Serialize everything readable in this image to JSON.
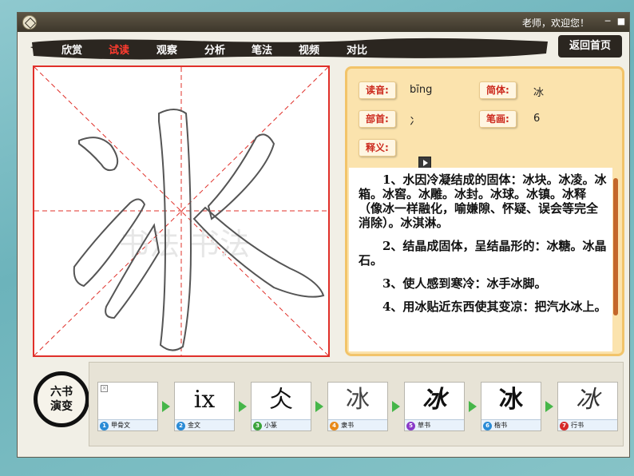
{
  "titlebar": {
    "welcome": "老师，欢迎您！",
    "minimize_icon": "minimize-icon",
    "close_icon": "close-icon",
    "colors": {
      "bar": "#4a4436"
    }
  },
  "nav": {
    "items": [
      {
        "label": "欣赏",
        "active": false
      },
      {
        "label": "试读",
        "active": true
      },
      {
        "label": "观察",
        "active": false
      },
      {
        "label": "分析",
        "active": false
      },
      {
        "label": "笔法",
        "active": false
      },
      {
        "label": "视频",
        "active": false
      },
      {
        "label": "对比",
        "active": false
      }
    ],
    "home_label": "返回首页",
    "active_color": "#ff3b2f"
  },
  "character": {
    "glyph": "冰",
    "grid_color": "#e0302a",
    "watermark": "书法 书法"
  },
  "info": {
    "pinyin_label": "读音:",
    "pinyin_value": "bīng",
    "simplified_label": "简体:",
    "simplified_value": "冰",
    "radical_label": "部首:",
    "radical_value": "冫",
    "strokes_label": "笔画:",
    "strokes_value": "6",
    "definition_label": "释义:",
    "play_icon": "play-icon",
    "definitions": [
      "1、水因冷凝结成的固体：冰块。冰凌。冰箱。冰窖。冰雕。冰封。冰球。冰镇。冰释（像冰一样融化，喻嫌隙、怀疑、误会等完全消除）。冰淇淋。",
      "2、结晶成固体，呈结晶形的：冰糖。冰晶石。",
      "3、使人感到寒冷：冰手冰脚。",
      "4、用冰贴近东西使其变凉：把汽水冰上。"
    ]
  },
  "evolution": {
    "badge_line1": "六书",
    "badge_line2": "演变",
    "stages": [
      {
        "num": "1",
        "label": "甲骨文",
        "glyph": "",
        "color": "#2a8bd6"
      },
      {
        "num": "2",
        "label": "金文",
        "glyph": "ⅸ",
        "color": "#2a8bd6"
      },
      {
        "num": "3",
        "label": "小篆",
        "glyph": "仌",
        "color": "#3aa33a"
      },
      {
        "num": "4",
        "label": "隶书",
        "glyph": "冰",
        "color": "#e88a1a"
      },
      {
        "num": "5",
        "label": "草书",
        "glyph": "冰",
        "color": "#8a3ac8"
      },
      {
        "num": "6",
        "label": "楷书",
        "glyph": "冰",
        "color": "#2a8bd6"
      },
      {
        "num": "7",
        "label": "行书",
        "glyph": "冰",
        "color": "#d62a2a"
      }
    ]
  }
}
